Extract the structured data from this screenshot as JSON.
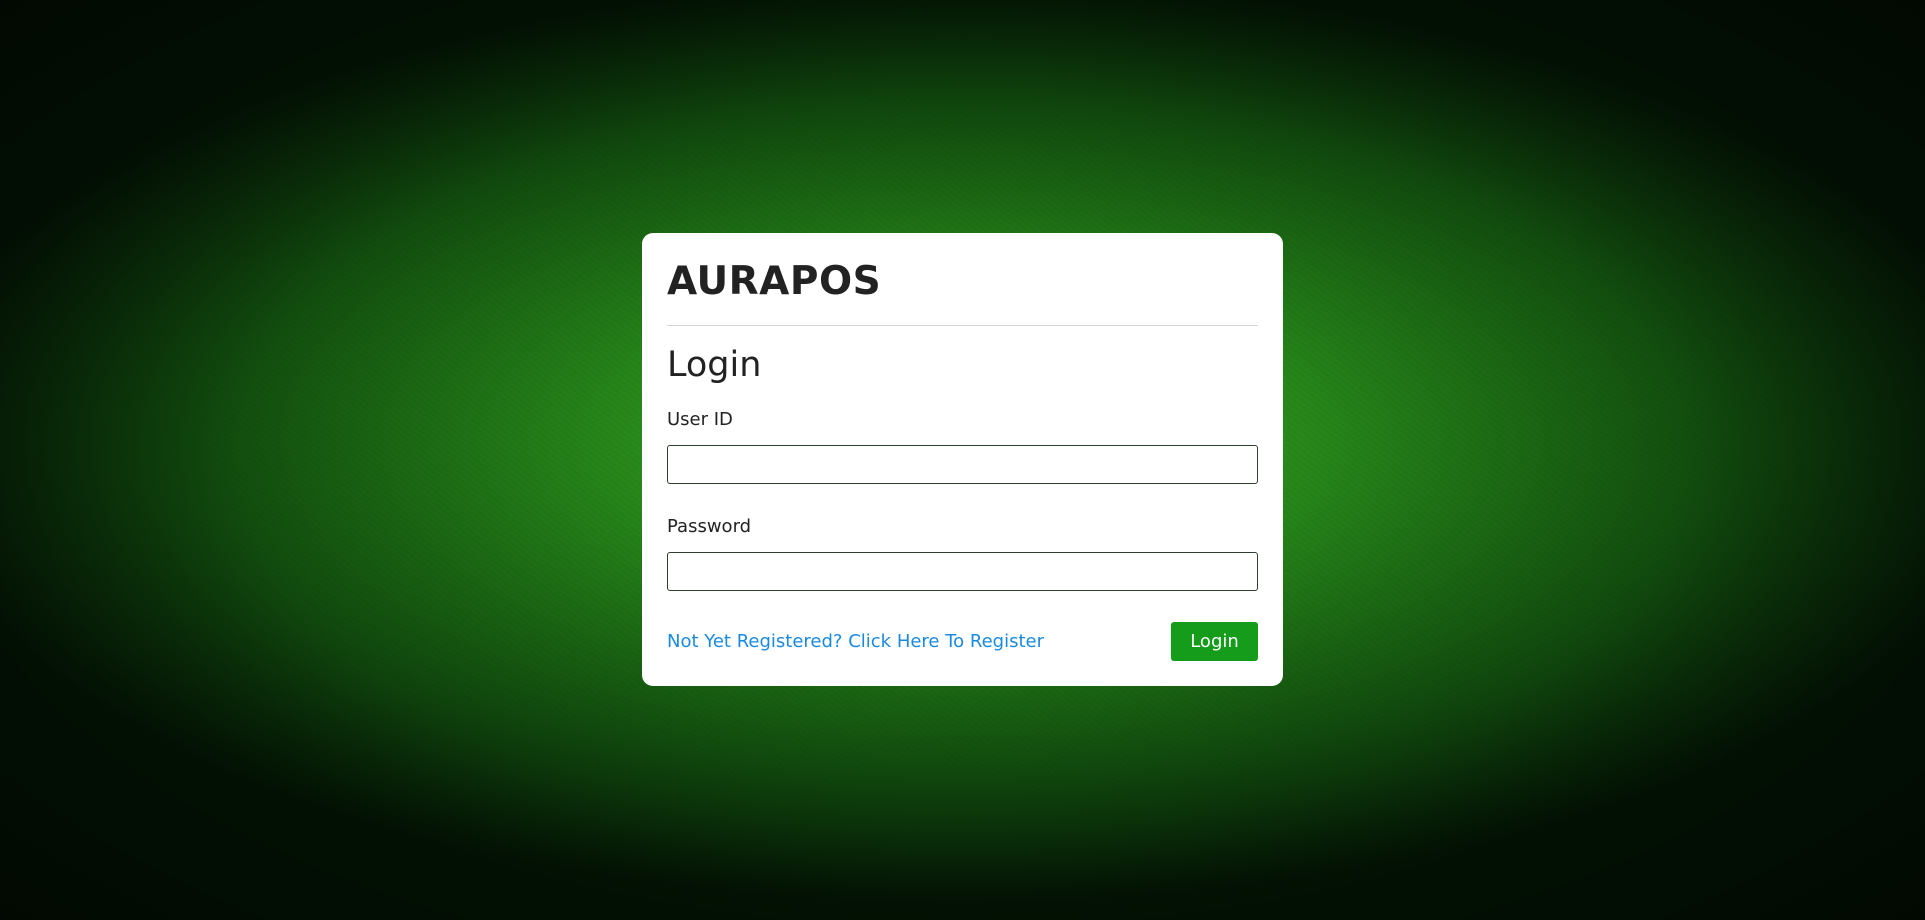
{
  "app": {
    "brand": "AURAPOS"
  },
  "login_form": {
    "heading": "Login",
    "user_id_label": "User ID",
    "user_id_value": "",
    "password_label": "Password",
    "password_value": "",
    "register_link": "Not Yet Registered? Click Here To Register",
    "submit_label": "Login"
  },
  "colors": {
    "background_green": "#2a9a1e",
    "button_green": "#149c1a",
    "link_blue": "#1a8ae0",
    "card_white": "#ffffff"
  }
}
